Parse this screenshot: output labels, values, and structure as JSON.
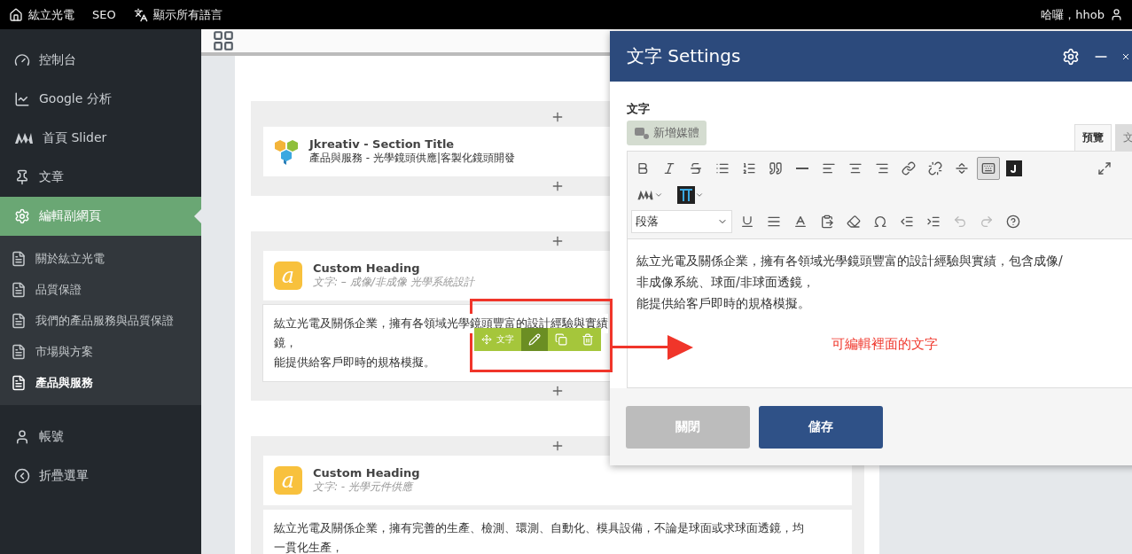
{
  "admin_bar": {
    "site": "紘立光電",
    "seo": "SEO",
    "languages": "顯示所有語言",
    "greeting": "哈囉，hhob"
  },
  "sidebar": {
    "items": [
      {
        "label": "控制台",
        "selected": false
      },
      {
        "label": "Google 分析",
        "selected": false
      },
      {
        "label": "首頁 Slider",
        "selected": false
      },
      {
        "label": "文章",
        "selected": false
      },
      {
        "label": "編輯副網頁",
        "selected": true,
        "children": [
          {
            "label": "關於紘立光電",
            "selected": false
          },
          {
            "label": "品質保證",
            "selected": false
          },
          {
            "label": "我們的產品服務與品質保證",
            "selected": false
          },
          {
            "label": "市場與方案",
            "selected": false
          },
          {
            "label": "產品與服務",
            "selected": true
          }
        ]
      },
      {
        "label": "帳號",
        "selected": false
      },
      {
        "label": "折疊選單",
        "selected": false
      }
    ]
  },
  "builder": {
    "sections": [
      {
        "elements": [
          {
            "kind": "title",
            "name": "Jkreativ - Section Title",
            "subtitle": "產品與服務 - 光學鏡頭供應|客製化鏡頭開發"
          }
        ]
      },
      {
        "elements": [
          {
            "kind": "heading",
            "logo_letter": "a",
            "name": "Custom Heading",
            "subtitle": "文字: – 成像/非成像 光學系統設計",
            "lines": [
              "紘立光電及關係企業，擁有各領域光學鏡頭豐富的設計經驗與實績",
              "鏡，",
              "能提供給客戶即時的規格模擬。"
            ],
            "hovered": true
          }
        ]
      },
      {
        "elements": [
          {
            "kind": "heading",
            "logo_letter": "a",
            "name": "Custom Heading",
            "subtitle": "文字: - 光學元件供應",
            "lines": [
              "紘立光電及關係企業，擁有完善的生產、檢測、環測、自動化、模具設備，不論是球面或求球面透鏡，均",
              "一貫化生產，"
            ],
            "hovered": false
          }
        ]
      }
    ]
  },
  "element_toolbar": {
    "label": "文字"
  },
  "annotation": {
    "text": "可編輯裡面的文字"
  },
  "modal": {
    "title": "文字 Settings",
    "field_label": "文字",
    "add_media": "新增媒體",
    "tabs": [
      {
        "label": "預覽",
        "selected": true
      },
      {
        "label": "文",
        "selected": false
      }
    ],
    "toolbar_toggle_pressed": true,
    "undo_disabled": true,
    "redo_disabled": true,
    "format_select": "段落",
    "content": [
      "紘立光電及關係企業，擁有各領域光學鏡頭豐富的設計經驗與實績，包含成像/",
      "非成像系統、球面/非球面透鏡，",
      "能提供給客戶即時的規格模擬。"
    ],
    "buttons": [
      {
        "label": "關閉",
        "kind": "secondary"
      },
      {
        "label": "儲存",
        "kind": "primary"
      }
    ]
  }
}
